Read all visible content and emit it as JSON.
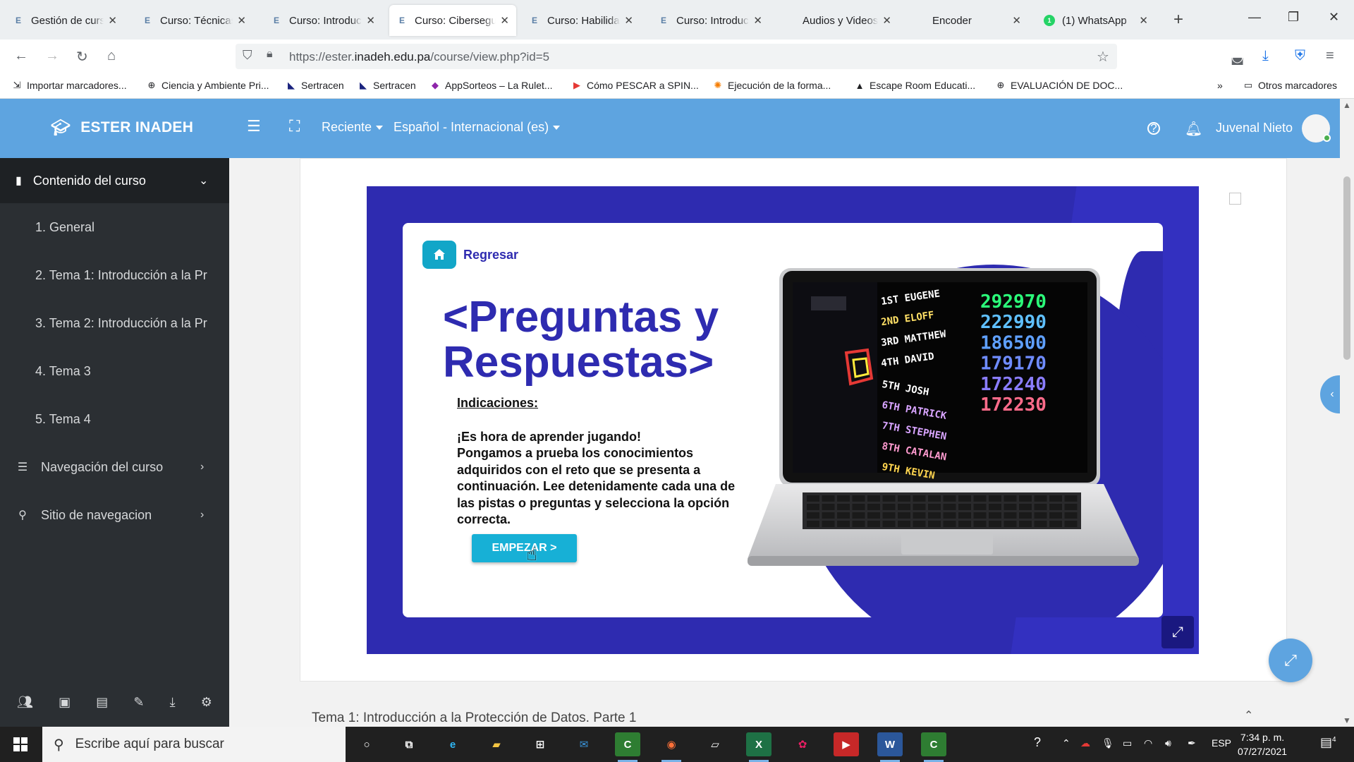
{
  "browser": {
    "tabs": [
      {
        "label": "Gestión de cursos",
        "favicon": "E",
        "active": false
      },
      {
        "label": "Curso: Técnicas b",
        "favicon": "E",
        "active": false
      },
      {
        "label": "Curso: Introducci",
        "favicon": "E",
        "active": false
      },
      {
        "label": "Curso: Cibersegu",
        "favicon": "E",
        "active": true
      },
      {
        "label": "Curso: Habilidad",
        "favicon": "E",
        "active": false
      },
      {
        "label": "Curso: Introducci",
        "favicon": "E",
        "active": false
      },
      {
        "label": "Audios y Videos",
        "favicon": "",
        "active": false
      },
      {
        "label": "Encoder",
        "favicon": "",
        "active": false
      },
      {
        "label": "(1) WhatsApp",
        "favicon": "whatsapp",
        "active": false
      }
    ],
    "url_prefix": "https://ester.",
    "url_domain": "inadeh.edu.pa",
    "url_path": "/course/view.php?id=5",
    "bookmarks": [
      {
        "label": "Importar marcadores...",
        "icon": "import-icon"
      },
      {
        "label": "Ciencia y Ambiente Pri...",
        "icon": "globe-icon"
      },
      {
        "label": "Sertracen",
        "icon": "sertracen-icon"
      },
      {
        "label": "Sertracen",
        "icon": "sertracen-icon"
      },
      {
        "label": "AppSorteos – La Rulet...",
        "icon": "appsorteos-icon"
      },
      {
        "label": "Cómo PESCAR a SPIN...",
        "icon": "youtube-icon"
      },
      {
        "label": "Ejecución de la forma...",
        "icon": "gear-icon"
      },
      {
        "label": "Escape Room Educati...",
        "icon": "triangle-icon"
      },
      {
        "label": "EVALUACIÓN DE DOC...",
        "icon": "globe-icon"
      }
    ],
    "other_bookmarks": "Otros marcadores"
  },
  "header": {
    "site_name": "ESTER INADEH",
    "recent": "Reciente",
    "language": "Español - Internacional (es)",
    "user_name": "Juvenal Nieto",
    "color": "#5ea4e0"
  },
  "sidebar": {
    "title": "Contenido del curso",
    "items": [
      "1.  General",
      "2.  Tema 1: Introducción a la Pr",
      "3.  Tema 2: Introducción a la Pr",
      "4.  Tema 3",
      "5.  Tema 4"
    ],
    "sections": [
      {
        "label": "Navegación del curso",
        "icon": "list-icon"
      },
      {
        "label": "Sitio de navegacion",
        "icon": "link-icon"
      }
    ],
    "tools": [
      "users-icon",
      "archive-icon",
      "file-icon",
      "brush-icon",
      "download-icon",
      "cogs-icon"
    ]
  },
  "activity": {
    "back_label": "Regresar",
    "title_line1": "<Preguntas y",
    "title_line2": "Respuestas>",
    "instructions_label": "Indicaciones:",
    "instructions_line1": "¡Es hora de aprender jugando!",
    "instructions_text": "Pongamos a prueba los conocimientos adquiridos con el reto que se presenta a continuación. Lee detenidamente cada una de las pistas o preguntas y selecciona la opción correcta.",
    "start_label": "EMPEZAR >",
    "brand_color": "#2e2bb0",
    "accent_color": "#17b0d6",
    "scoreboard": [
      {
        "rank": "1ST",
        "name": "EUGENE",
        "score": "292970"
      },
      {
        "rank": "2ND",
        "name": "ELOFF",
        "score": "222990"
      },
      {
        "rank": "3RD",
        "name": "MATTHEW",
        "score": "186500"
      },
      {
        "rank": "4TH",
        "name": "DAVID",
        "score": "179170"
      },
      {
        "rank": "5TH",
        "name": "JOSH",
        "score": "172240"
      },
      {
        "rank": "6TH",
        "name": "PATRICK",
        "score": "172230"
      },
      {
        "rank": "7TH",
        "name": "STEPHEN",
        "score": ""
      },
      {
        "rank": "8TH",
        "name": "CATALAN",
        "score": ""
      },
      {
        "rank": "9TH",
        "name": "KEVIN",
        "score": ""
      }
    ]
  },
  "section_title": "Tema 1: Introducción a la Protección de Datos. Parte 1",
  "taskbar": {
    "search_placeholder": "Escribe aquí para buscar",
    "apps": [
      "cortana-icon",
      "task-view-icon",
      "edge-icon",
      "file-explorer-icon",
      "store-icon",
      "mail-icon",
      "camtasia-icon",
      "firefox-icon",
      "app-icon",
      "excel-icon",
      "paint-icon",
      "video-icon",
      "word-icon",
      "camtasia-icon"
    ],
    "language": "ESP",
    "time": "7:34 p. m.",
    "date": "07/27/2021",
    "notifications": "4"
  }
}
